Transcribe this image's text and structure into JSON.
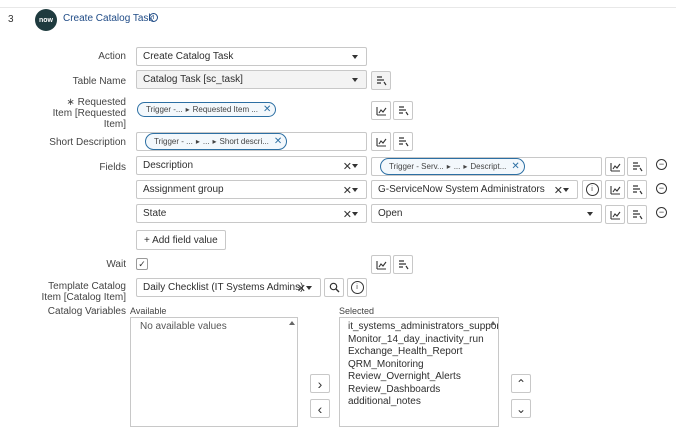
{
  "step": {
    "number": "3",
    "logo_text": "now",
    "title": "Create Catalog Task"
  },
  "labels": {
    "action": "Action",
    "table_name": "Table Name",
    "requested_item_line1": "∗ Requested",
    "requested_item_line2": "Item [Requested",
    "requested_item_line3": "Item]",
    "short_description": "Short Description",
    "fields": "Fields",
    "wait": "Wait",
    "template_line1": "Template Catalog",
    "template_line2": "Item [Catalog Item]",
    "catalog_variables": "Catalog Variables",
    "available": "Available",
    "selected": "Selected"
  },
  "action": {
    "value": "Create Catalog Task"
  },
  "table_name": {
    "value": "Catalog Task [sc_task]"
  },
  "requested_item": {
    "pill_part1": "Trigger -...",
    "pill_part2": "Requested Item ..."
  },
  "short_description": {
    "pill_part1": "Trigger - ...",
    "pill_part2": "...",
    "pill_part3": "Short descri..."
  },
  "fields": [
    {
      "name": "Description",
      "value_pill": {
        "part1": "Trigger - Serv...",
        "part2": "...",
        "part3": "Descript..."
      }
    },
    {
      "name": "Assignment group",
      "value": "G-ServiceNow System Administrators"
    },
    {
      "name": "State",
      "value": "Open"
    }
  ],
  "add_field_value_label": "+ Add field value",
  "wait": {
    "checked": true,
    "check_glyph": "✓"
  },
  "template_catalog_item": {
    "value": "Daily Checklist (IT Systems Admins)"
  },
  "catalog_variables": {
    "available_empty": "No available values",
    "selected_items": [
      "it_systems_administrators_suppor",
      "Monitor_14_day_inactivity_run",
      "Exchange_Health_Report",
      "QRM_Monitoring",
      "Review_Overnight_Alerts",
      "Review_Dashboards",
      "additional_notes"
    ]
  },
  "glyphs": {
    "clear": "✕",
    "minus": "−",
    "info": "i",
    "move_right": "›",
    "move_left": "‹",
    "move_up": "⌃",
    "move_down": "⌄",
    "arrow": "▸"
  },
  "icons": [
    "servicenow-logo",
    "info-icon",
    "reference-lookup-icon",
    "data-pill-picker-icon",
    "chart-icon",
    "remove-icon",
    "search-icon",
    "check-icon"
  ]
}
